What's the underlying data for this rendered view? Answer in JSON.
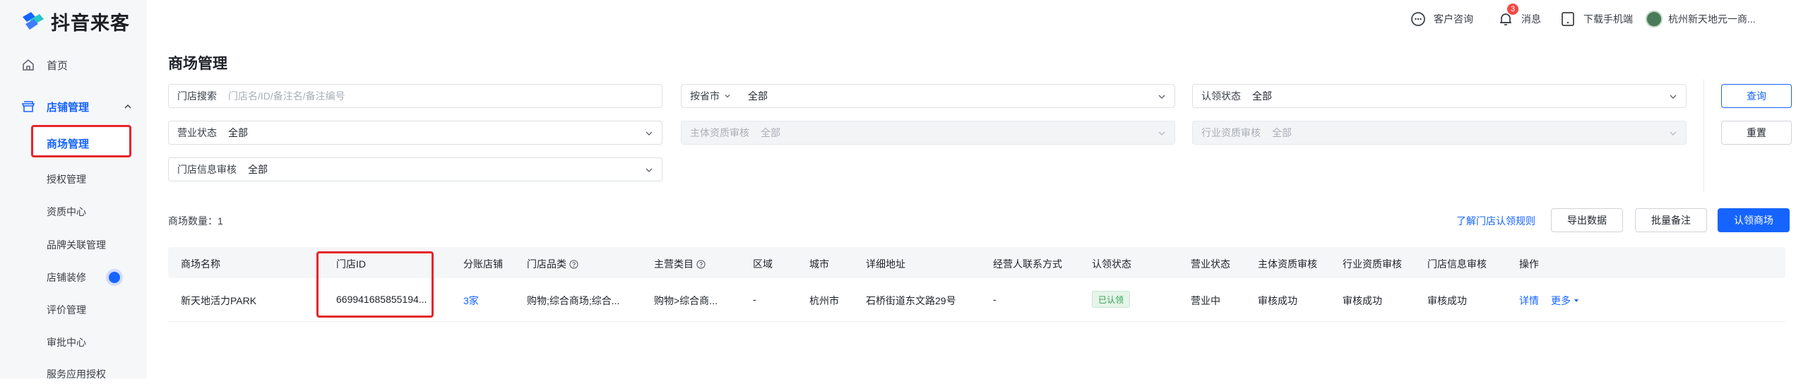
{
  "app": {
    "logo_text": "抖音来客"
  },
  "sidebar": {
    "home": "首页",
    "store_management": "店铺管理",
    "sub_items": [
      {
        "label": "商场管理"
      },
      {
        "label": "授权管理"
      },
      {
        "label": "资质中心"
      },
      {
        "label": "品牌关联管理"
      },
      {
        "label": "店铺装修"
      },
      {
        "label": "评价管理"
      },
      {
        "label": "审批中心"
      },
      {
        "label": "服务应用授权"
      }
    ]
  },
  "topbar": {
    "customer_service": "客户咨询",
    "messages": "消息",
    "message_badge": "3",
    "download_app": "下载手机端",
    "account_name": "杭州新天地元一商..."
  },
  "page": {
    "title": "商场管理",
    "filters": {
      "store_search_label": "门店搜索",
      "store_search_placeholder": "门店名/ID/备注名/备注编号",
      "province_label": "按省市",
      "province_value": "全部",
      "claim_status_label": "认领状态",
      "claim_status_value": "全部",
      "business_status_label": "营业状态",
      "business_status_value": "全部",
      "entity_review_label": "主体资质审核",
      "entity_review_value": "全部",
      "industry_review_label": "行业资质审核",
      "industry_review_value": "全部",
      "store_info_review_label": "门店信息审核",
      "store_info_review_value": "全部"
    },
    "buttons": {
      "query": "查询",
      "reset": "重置",
      "export": "导出数据",
      "batch_note": "批量备注",
      "claim_mall": "认领商场"
    },
    "count_text": "商场数量：1",
    "rule_link": "了解门店认领规则"
  },
  "table": {
    "headers": [
      "商场名称",
      "门店ID",
      "分账店铺",
      "门店品类",
      "主营类目",
      "区域",
      "城市",
      "详细地址",
      "经营人联系方式",
      "认领状态",
      "营业状态",
      "主体资质审核",
      "行业资质审核",
      "门店信息审核",
      "操作"
    ],
    "rows": [
      {
        "name": "新天地活力PARK",
        "store_id": "669941685855194...",
        "split_stores": "3家",
        "category": "购物;综合商场;综合...",
        "main_category": "购物>综合商...",
        "region": "-",
        "city": "杭州市",
        "address": "石桥街道东文路29号",
        "contact": "-",
        "claim_status": "已认领",
        "business_status": "营业中",
        "entity_review": "审核成功",
        "industry_review": "审核成功",
        "store_info_review": "审核成功",
        "action_detail": "详情",
        "action_more": "更多"
      }
    ]
  },
  "colors": {
    "brand": "#1664ff",
    "highlight": "#e5262b",
    "success": "#2ea44f"
  }
}
